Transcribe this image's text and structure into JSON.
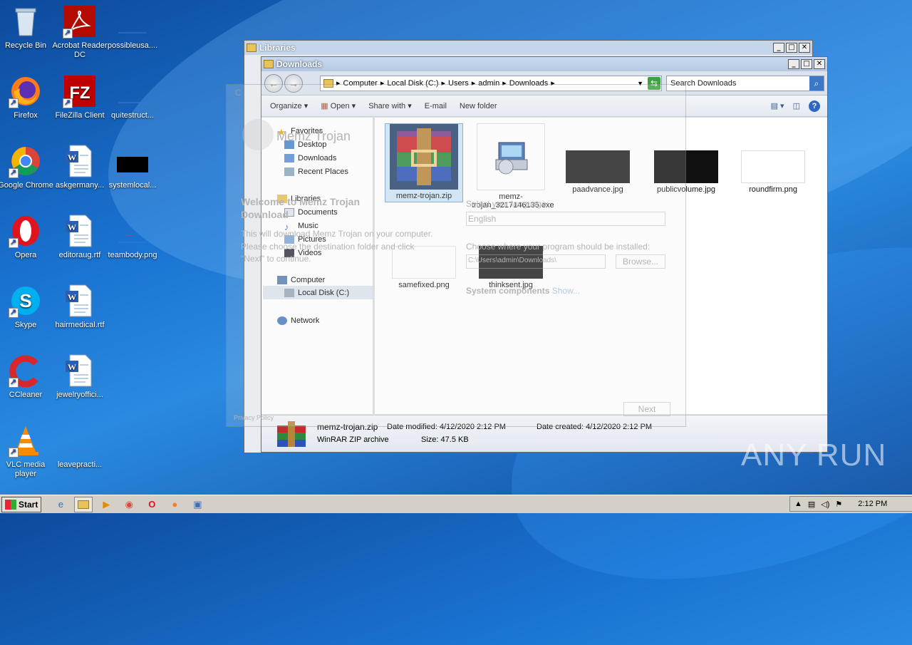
{
  "desktop": {
    "icons": [
      {
        "label": "Recycle Bin"
      },
      {
        "label": "Acrobat Reader DC"
      },
      {
        "label": "possibleusa...."
      },
      {
        "label": "Firefox"
      },
      {
        "label": "FileZilla Client"
      },
      {
        "label": "quitestruct..."
      },
      {
        "label": "Google Chrome"
      },
      {
        "label": "askgermany..."
      },
      {
        "label": "systemlocal..."
      },
      {
        "label": "Opera"
      },
      {
        "label": "editoraug.rtf"
      },
      {
        "label": "teambody.png"
      },
      {
        "label": "Skype"
      },
      {
        "label": "hairmedical.rtf"
      },
      {
        "label": "CCleaner"
      },
      {
        "label": "jewelryoffici..."
      },
      {
        "label": "VLC media player"
      },
      {
        "label": "leavepracti..."
      }
    ]
  },
  "libraries_window": {
    "title": "Libraries"
  },
  "installer_ghost": {
    "title_partial": "C",
    "brand": "Memz Trojan",
    "welcome": "Welcome to Memz Trojan",
    "download": "Download",
    "desc1": "This will download Memz Trojan on your computer.",
    "desc2": "Please choose the destination folder and click",
    "desc3": "\"Next\" to continue.",
    "select_lang": "Select your language:",
    "language": "English",
    "choose_where": "Choose where your program should be installed:",
    "path": "C:\\Users\\admin\\Downloads\\",
    "browse": "Browse...",
    "system_components": "System components",
    "show": "Show...",
    "next": "Next",
    "privacy": "Privacy Policy"
  },
  "downloads_window": {
    "title": "Downloads",
    "breadcrumbs": [
      "Computer",
      "Local Disk (C:)",
      "Users",
      "admin",
      "Downloads"
    ],
    "search_placeholder": "Search Downloads",
    "toolbar": {
      "organize": "Organize",
      "open": "Open",
      "share": "Share with",
      "email": "E-mail",
      "new_folder": "New folder"
    },
    "nav": {
      "favorites": "Favorites",
      "desktop": "Desktop",
      "downloads": "Downloads",
      "recent": "Recent Places",
      "libraries": "Libraries",
      "documents": "Documents",
      "music": "Music",
      "pictures": "Pictures",
      "videos": "Videos",
      "computer": "Computer",
      "localdisk": "Local Disk (C:)",
      "network": "Network"
    },
    "files": [
      {
        "name": "memz-trojan.zip"
      },
      {
        "name": "memz-trojan_3217146135.exe"
      },
      {
        "name": "paadvance.jpg"
      },
      {
        "name": "publicvolume.jpg"
      },
      {
        "name": "roundfirm.png"
      },
      {
        "name": "samefixed.png"
      },
      {
        "name": "thinksent.jpg"
      }
    ],
    "details": {
      "name": "memz-trojan.zip",
      "type": "WinRAR ZIP archive",
      "modified_label": "Date modified:",
      "modified": "4/12/2020 2:12 PM",
      "size_label": "Size:",
      "size": "47.5 KB",
      "created_label": "Date created:",
      "created": "4/12/2020 2:12 PM"
    }
  },
  "taskbar": {
    "start": "Start",
    "time": "2:12 PM"
  },
  "watermark": "ANY RUN",
  "colors": {
    "selection": "#cde4f7",
    "titlebar_active": "#c5d5ea",
    "accent_red": "#c9181e"
  }
}
